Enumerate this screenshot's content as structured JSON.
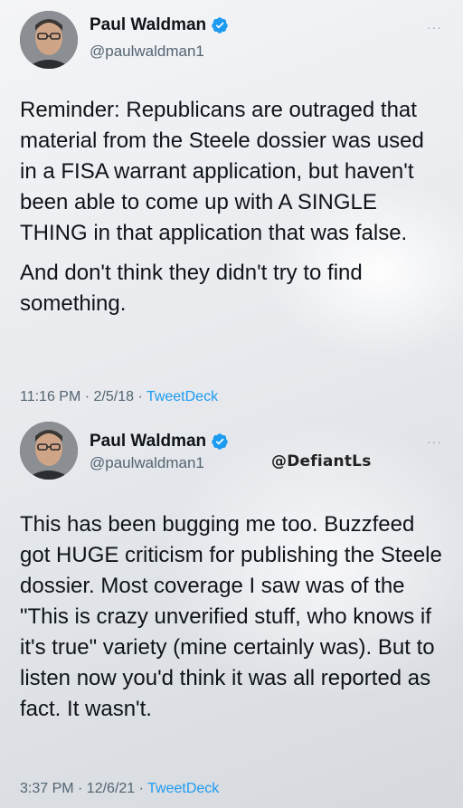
{
  "tweet1": {
    "name": "Paul Waldman",
    "handle": "@paulwaldman1",
    "more": "···",
    "paragraph1": "Reminder: Republicans are outraged that material from the Steele dossier was used in a FISA warrant application, but haven't been able to come up with A SINGLE THING in that application that was false.",
    "paragraph2": "And don't think they didn't try to find something.",
    "time": "11:16 PM · 2/5/18 · ",
    "app": "TweetDeck"
  },
  "tweet2": {
    "name": "Paul Waldman",
    "handle": "@paulwaldman1",
    "more": "···",
    "watermark": "@DefiantLs",
    "paragraph1": "This has been bugging me too. Buzzfeed got HUGE criticism for publishing the Steele dossier. Most coverage I saw was of the \"This is crazy unverified stuff, who knows if it's true\" variety (mine certainly was). But to listen now you'd think it was all reported as fact. It wasn't.",
    "time": "3:37 PM · 12/6/21 · ",
    "app": "TweetDeck"
  },
  "colors": {
    "verified": "#1d9bf0",
    "link": "#1d9bf0",
    "secondary_text": "#536471"
  }
}
